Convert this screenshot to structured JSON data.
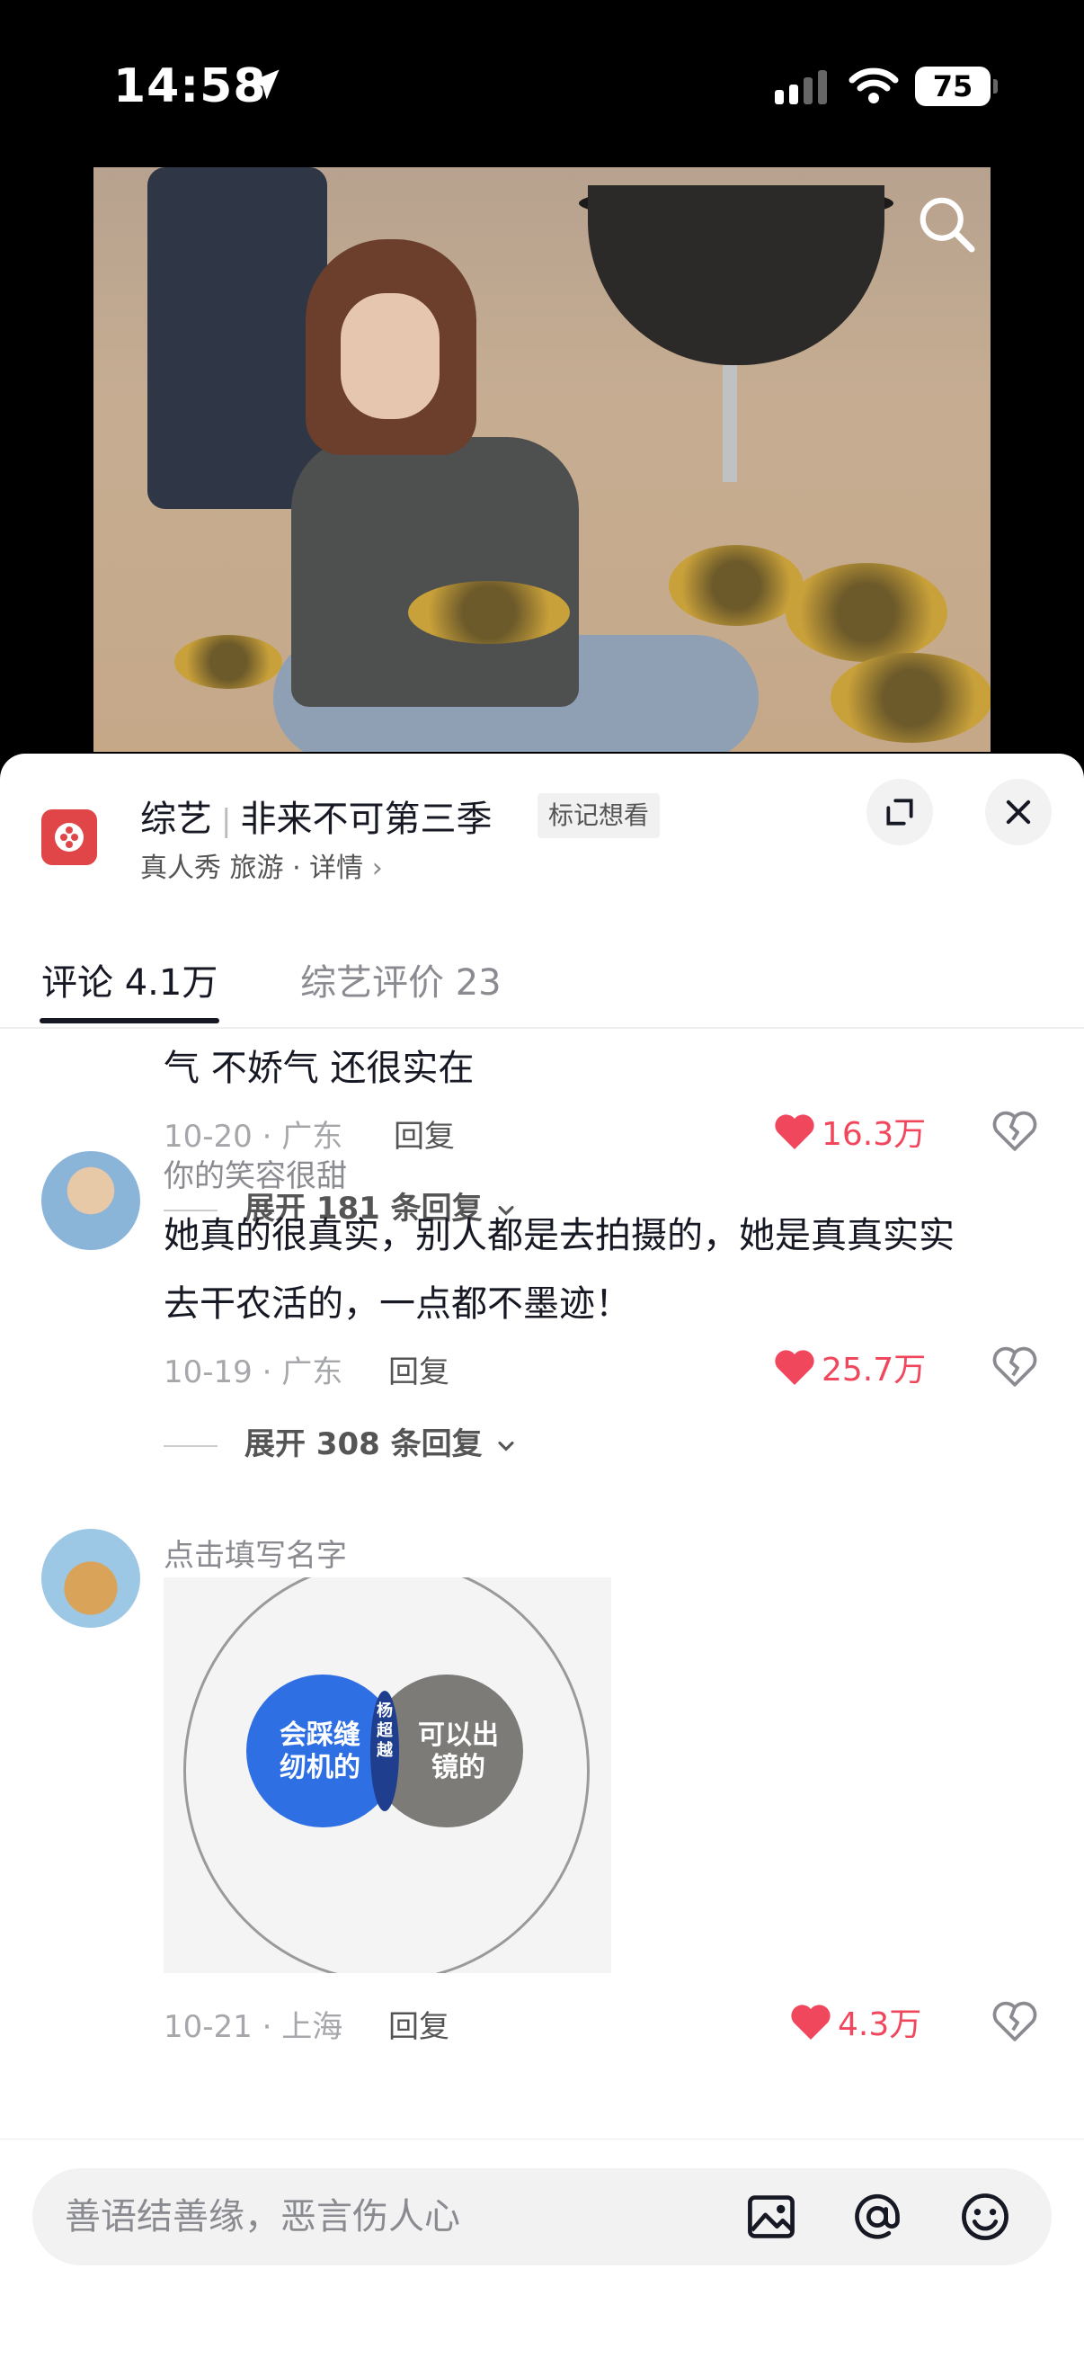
{
  "status_bar": {
    "time": "14:58",
    "battery": "75"
  },
  "show": {
    "category": "综艺",
    "name": "非来不可第三季",
    "mark_label": "标记想看",
    "subtitle": "真人秀 旅游 · 详情",
    "subtitle_chevron": "›"
  },
  "tabs": [
    {
      "label": "评论 4.1万"
    },
    {
      "label": "综艺评价 23"
    }
  ],
  "comments": [
    {
      "text_lines": [
        "气 不娇气 还很实在"
      ],
      "date_location": "10-20 · 广东",
      "reply_label": "回复",
      "likes": "16.3万",
      "expand": "展开 181 条回复"
    },
    {
      "username": "你的笑容很甜",
      "text_lines": [
        "她真的很真实，别人都是去拍摄的，她是真真实实",
        "去干农活的，一点都不墨迹！"
      ],
      "date_location": "10-19 · 广东",
      "reply_label": "回复",
      "likes": "25.7万",
      "expand": "展开 308 条回复"
    },
    {
      "username": "点击填写名字",
      "image_labels": {
        "left": "会踩缝\n纫机的",
        "right": "可以出\n镜的",
        "center": "杨\n超\n越"
      },
      "date_location": "10-21 · 上海",
      "reply_label": "回复",
      "likes": "4.3万"
    }
  ],
  "input": {
    "placeholder": "善语结善缘，恶言伤人心"
  },
  "colors": {
    "like": "#f0475d",
    "accent_logo": "#e04547",
    "venn_blue": "#2f6fe4",
    "venn_grey": "#7c7b78"
  },
  "icons": [
    "location-arrow-icon",
    "signal-icon",
    "wifi-icon",
    "battery-icon",
    "search-icon",
    "expand-icon",
    "close-icon",
    "heart-icon",
    "broken-heart-icon",
    "chevron-down-icon",
    "image-icon",
    "at-icon",
    "emoji-icon"
  ]
}
